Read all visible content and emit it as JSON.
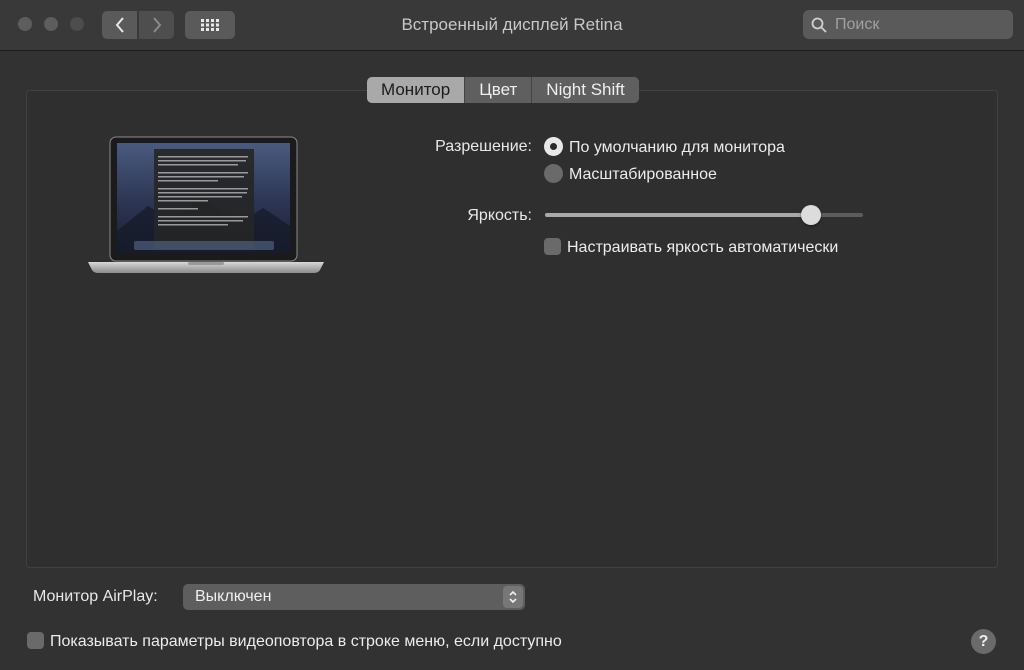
{
  "window": {
    "title": "Встроенный дисплей Retina"
  },
  "search": {
    "placeholder": "Поиск"
  },
  "tabs": [
    {
      "label": "Монитор",
      "active": true
    },
    {
      "label": "Цвет",
      "active": false
    },
    {
      "label": "Night Shift",
      "active": false
    }
  ],
  "resolution": {
    "label": "Разрешение:",
    "options": [
      {
        "label": "По умолчанию для монитора",
        "selected": true
      },
      {
        "label": "Масштабированное",
        "selected": false
      }
    ]
  },
  "brightness": {
    "label": "Яркость:",
    "level": 0.86,
    "auto_label": "Настраивать яркость автоматически",
    "auto_checked": false
  },
  "airplay": {
    "label": "Монитор AirPlay:",
    "value": "Выключен"
  },
  "mirroring": {
    "label": "Показывать параметры видеоповтора в строке меню, если доступно",
    "checked": false
  },
  "icons": {
    "back": "chevron-left-icon",
    "forward": "chevron-right-icon",
    "grid": "grid-icon",
    "search": "search-icon",
    "help": "help-icon"
  }
}
